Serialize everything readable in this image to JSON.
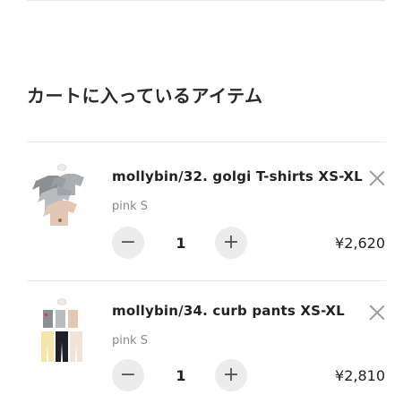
{
  "page": {
    "title": "カートに入っているアイテム"
  },
  "items": [
    {
      "name": "mollybin/32. golgi T-shirts XS-XL",
      "variant": "pink S",
      "quantity": "1",
      "price": "¥2,620",
      "minus_label": "−",
      "plus_label": "+"
    },
    {
      "name": "mollybin/34. curb pants XS-XL",
      "variant": "pink S",
      "quantity": "1",
      "price": "¥2,810",
      "minus_label": "−",
      "plus_label": "+"
    }
  ],
  "icons": {
    "remove": "close-icon",
    "decrease": "minus-icon",
    "increase": "plus-icon"
  },
  "colors": {
    "divider": "#e6e6e6",
    "qty_button_bg": "#ececec",
    "variant_text": "#8a8a8a"
  }
}
